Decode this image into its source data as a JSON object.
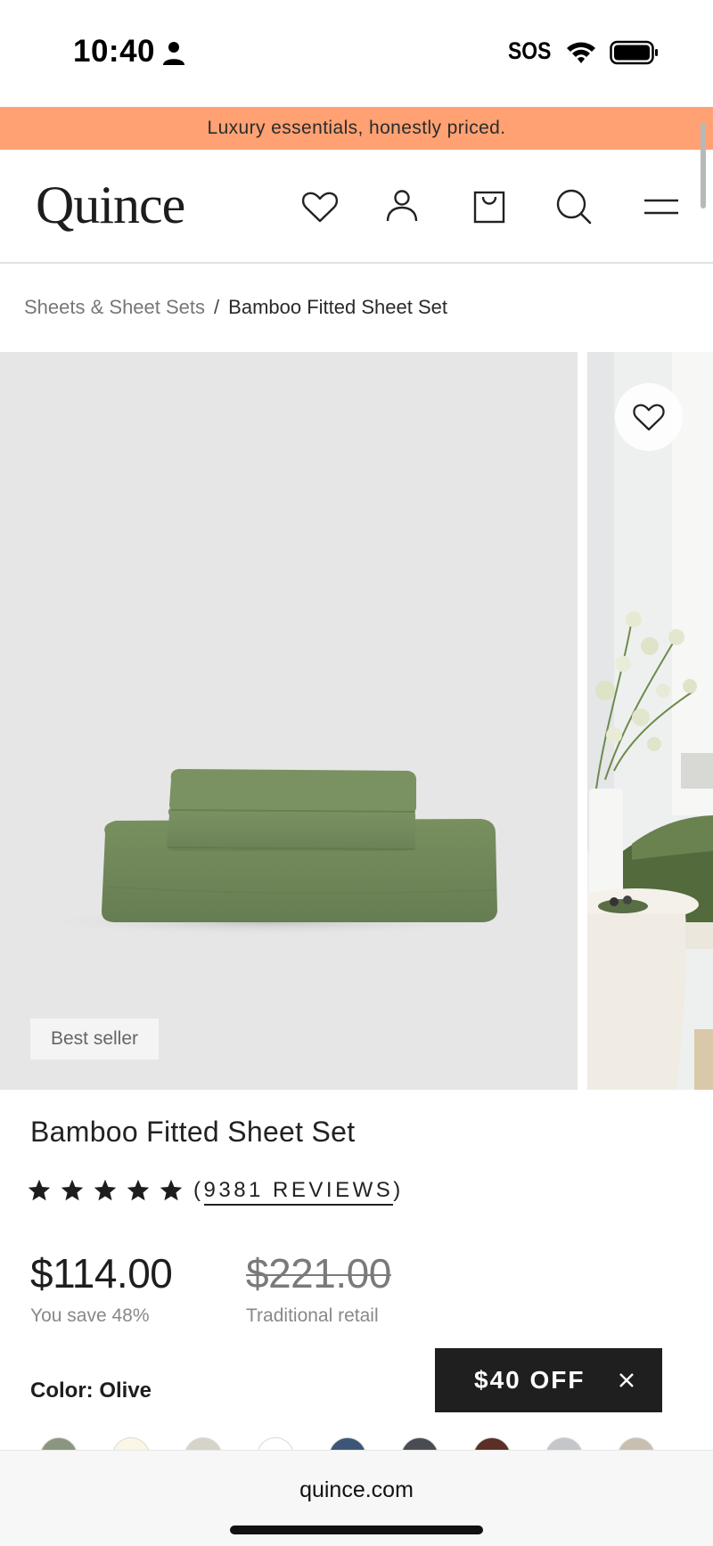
{
  "status_bar": {
    "time": "10:40",
    "carrier_text": "SOS"
  },
  "promo": {
    "text": "Luxury essentials, honestly priced."
  },
  "header": {
    "logo": "Quince",
    "icons": [
      "heart-icon",
      "account-icon",
      "cart-icon",
      "search-icon",
      "menu-icon"
    ]
  },
  "breadcrumb": {
    "parent": "Sheets & Sheet Sets",
    "separator": "/",
    "current": "Bamboo Fitted Sheet Set"
  },
  "gallery": {
    "badge": "Best seller",
    "product_color": "#6e8458"
  },
  "product": {
    "title": "Bamboo Fitted Sheet Set",
    "rating_stars": 5,
    "reviews_open": "(",
    "reviews_text": "9381 REVIEWS",
    "reviews_close": ")",
    "price": "$114.00",
    "savings": "You save 48%",
    "retail_price": "$221.00",
    "retail_label": "Traditional retail",
    "color_label": "Color: Olive"
  },
  "swatches": [
    "#8a9680",
    "#fbf7e5",
    "#d6d4c8",
    "#ffffff",
    "#3d5676",
    "#494c52",
    "#5a2f25",
    "#c4c6c9",
    "#c8bfb0"
  ],
  "offer": {
    "text": "$40 OFF"
  },
  "browser": {
    "url": "quince.com"
  },
  "colors": {
    "promo_bg": "#ffa173",
    "offer_bg": "#1f1f1f"
  }
}
